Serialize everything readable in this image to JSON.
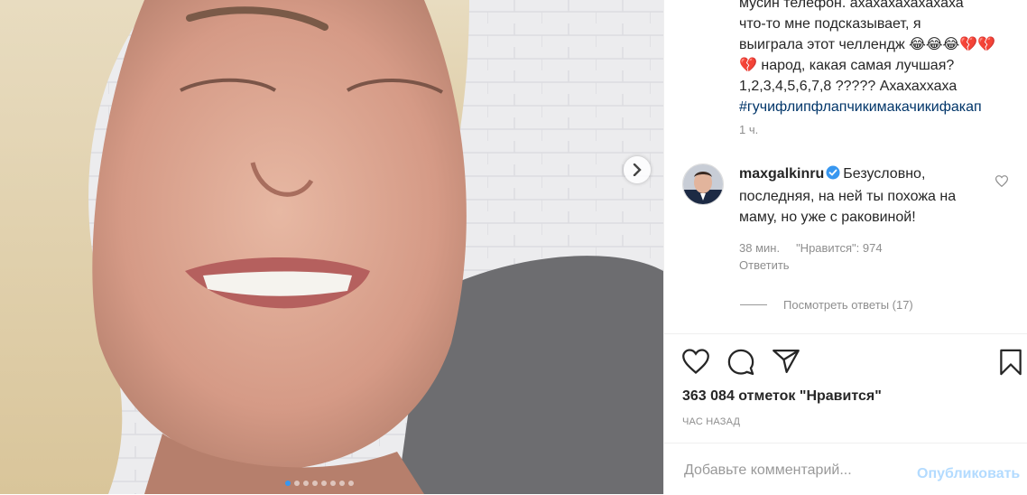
{
  "post": {
    "caption_lines": [
      "мусин телефон. ахахахахахахаха",
      "что-то мне подсказывает, я",
      "выиграла этот челлендж 😂😂😂💔💔",
      "💔 народ, какая самая лучшая?",
      "1,2,3,4,5,6,7,8 ????? Ахахаххаха"
    ],
    "hashtag": "#гучифлипфлапчикимакачикифакап",
    "caption_time": "1 ч."
  },
  "comment": {
    "username": "maxgalkinru",
    "text": "Безусловно, последняя, на ней ты похожа на маму, но уже с раковиной!",
    "time": "38 мин.",
    "likes_text": "\"Нравится\": 974",
    "reply_label": "Ответить",
    "view_replies_label": "Посмотреть ответы (17)"
  },
  "actions": {
    "like_icon": "heart-icon",
    "comment_icon": "comment-icon",
    "share_icon": "paper-plane-icon",
    "save_icon": "bookmark-icon"
  },
  "likes_count": "363 084 отметок \"Нравится\"",
  "posted_ago": "ЧАС НАЗАД",
  "add_comment": {
    "placeholder": "Добавьте комментарий...",
    "publish_label": "Опубликовать"
  },
  "carousel": {
    "slide_count": 8,
    "active_index": 0
  },
  "colors": {
    "link": "#003569",
    "active_dot": "#3897f0",
    "publish_disabled": "#b3dbff",
    "muted": "#8e8e8e"
  }
}
